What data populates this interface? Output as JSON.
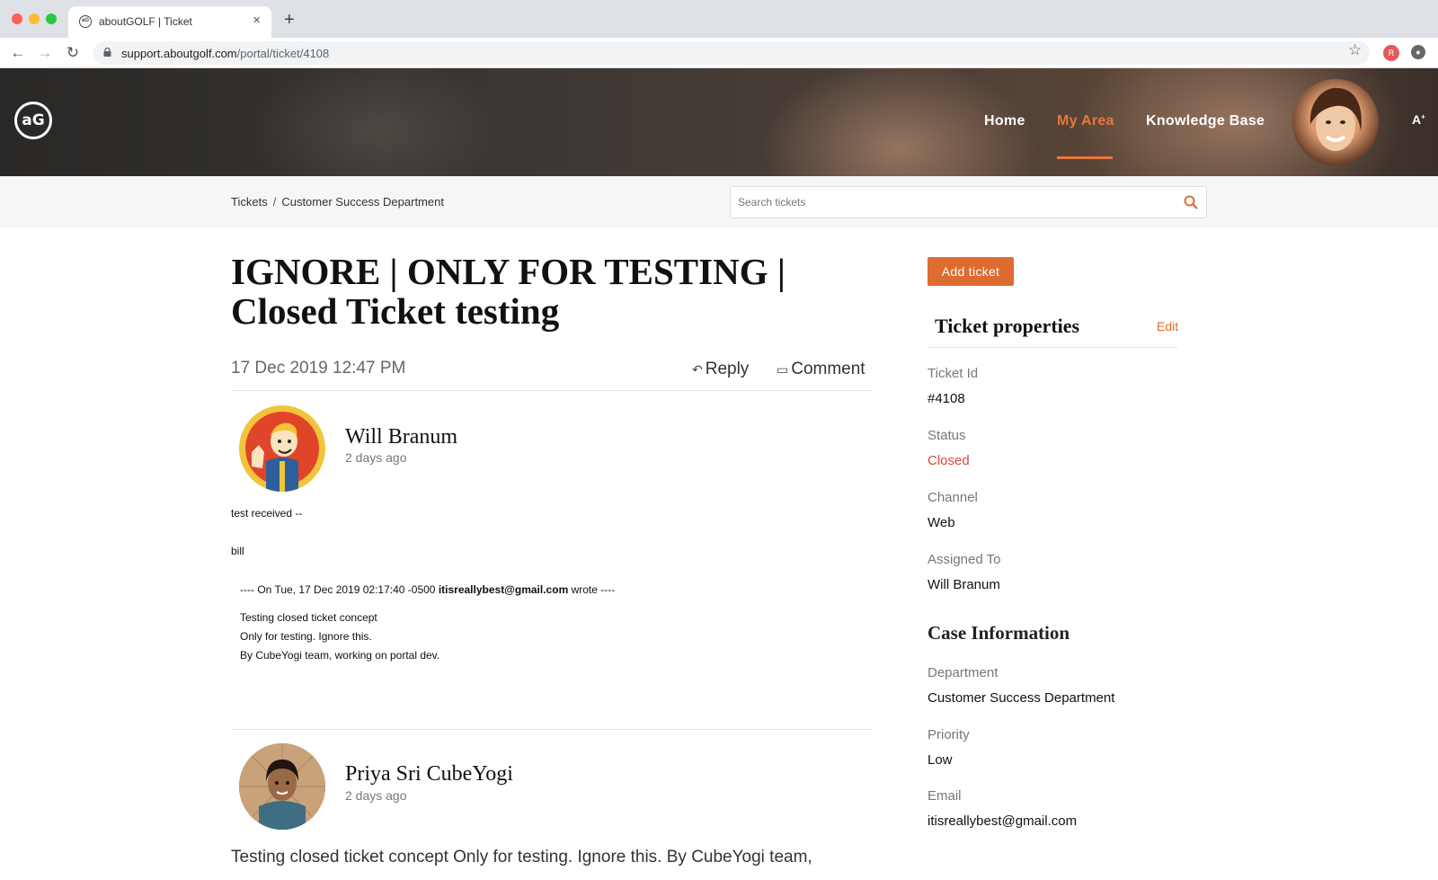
{
  "browser": {
    "tab_title": "aboutGOLF | Ticket",
    "tab_favicon": "aG",
    "url_host": "support.aboutgolf.com",
    "url_path": "/portal/ticket/4108",
    "profile_initial": "R"
  },
  "header": {
    "logo_text": "aG",
    "nav": {
      "home": "Home",
      "my_area": "My Area",
      "knowledge_base": "Knowledge Base"
    },
    "font_toggle": "A"
  },
  "breadcrumb": {
    "root": "Tickets",
    "separator": "/",
    "current": "Customer Success Department"
  },
  "search": {
    "placeholder": "Search tickets"
  },
  "ticket": {
    "title": "IGNORE | ONLY FOR TESTING | Closed Ticket testing",
    "date": "17 Dec 2019 12:47 PM",
    "reply_label": "Reply",
    "comment_label": "Comment"
  },
  "threads": [
    {
      "author": "Will Branum",
      "time": "2 days ago",
      "lines": [
        "test received --",
        "bill"
      ],
      "quote_prefix": "---- On  Tue, 17 Dec 2019 02:17:40 -0500",
      "quote_email": "itisreallybest@gmail.com",
      "quote_suffix": "wrote ----",
      "quote_lines": [
        "Testing closed ticket concept",
        "Only for testing. Ignore this.",
        "By CubeYogi team, working on portal dev."
      ]
    },
    {
      "author": "Priya Sri CubeYogi",
      "time": "2 days ago",
      "body": "Testing closed ticket concept Only for testing. Ignore this. By CubeYogi team,"
    }
  ],
  "sidebar": {
    "add_ticket": "Add ticket",
    "properties_title": "Ticket properties",
    "edit_label": "Edit",
    "properties": [
      {
        "label": "Ticket Id",
        "value": "#4108"
      },
      {
        "label": "Status",
        "value": "Closed"
      },
      {
        "label": "Channel",
        "value": "Web"
      },
      {
        "label": "Assigned To",
        "value": "Will Branum"
      }
    ],
    "case_title": "Case Information",
    "case": [
      {
        "label": "Department",
        "value": "Customer Success Department"
      },
      {
        "label": "Priority",
        "value": "Low"
      },
      {
        "label": "Email",
        "value": "itisreallybest@gmail.com"
      }
    ]
  },
  "colors": {
    "accent": "#de6b2f",
    "status_closed": "#d44a3a",
    "nav_active": "#e8763a"
  },
  "icons": [
    "lock-icon",
    "star-icon",
    "search-icon",
    "reply-icon",
    "comment-icon",
    "back-icon",
    "forward-icon",
    "reload-icon",
    "close-icon",
    "plus-icon"
  ]
}
